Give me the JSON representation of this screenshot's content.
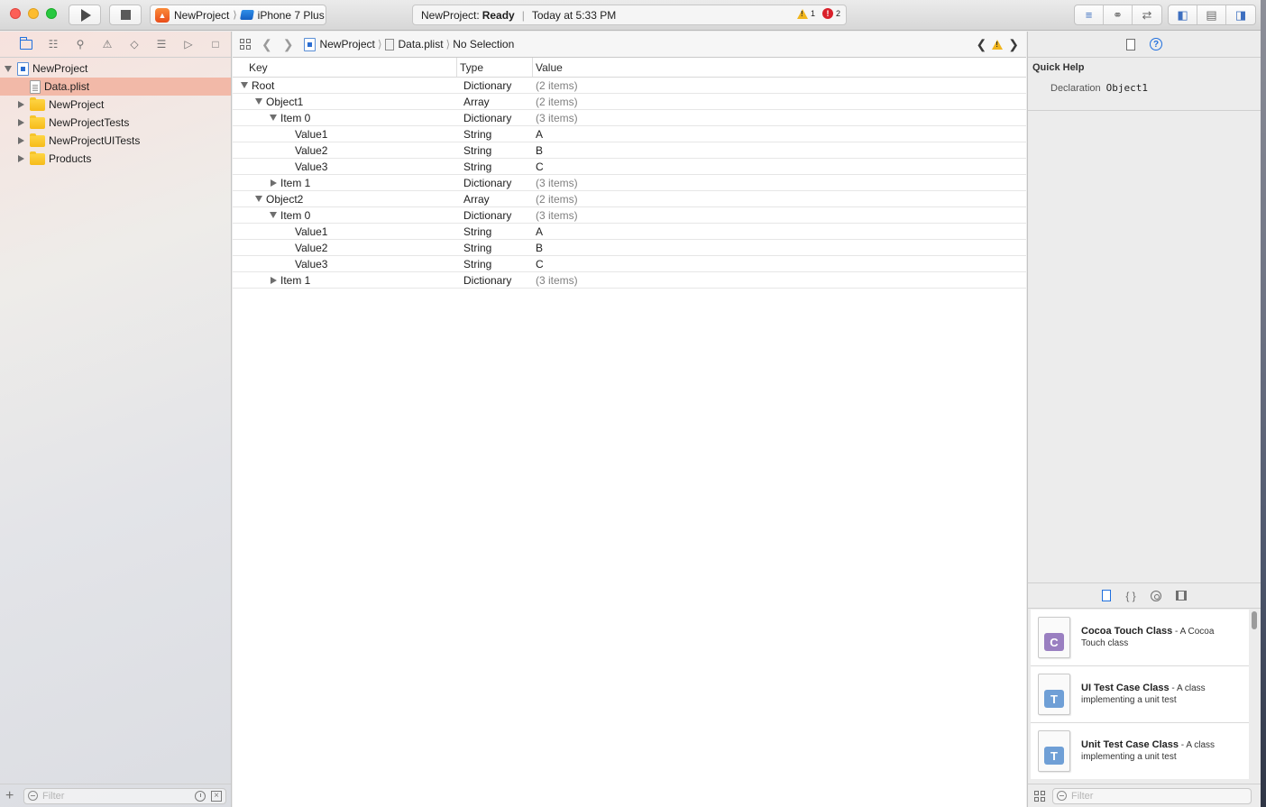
{
  "toolbar": {
    "scheme": {
      "project": "NewProject",
      "device": "iPhone 7 Plus"
    },
    "activity": {
      "project": "NewProject:",
      "status": "Ready",
      "time": "Today at 5:33 PM",
      "warnings": "1",
      "errors": "2"
    }
  },
  "navigator": {
    "tree": [
      {
        "label": "NewProject",
        "kind": "project",
        "level": 0,
        "expanded": true
      },
      {
        "label": "Data.plist",
        "kind": "file",
        "level": 1,
        "selected": true
      },
      {
        "label": "NewProject",
        "kind": "folder",
        "level": 1
      },
      {
        "label": "NewProjectTests",
        "kind": "folder",
        "level": 1
      },
      {
        "label": "NewProjectUITests",
        "kind": "folder",
        "level": 1
      },
      {
        "label": "Products",
        "kind": "folder",
        "level": 1
      }
    ],
    "filter_placeholder": "Filter"
  },
  "jumpbar": {
    "project": "NewProject",
    "file": "Data.plist",
    "selection": "No Selection"
  },
  "plist": {
    "columns": {
      "key": "Key",
      "type": "Type",
      "value": "Value"
    },
    "rows": [
      {
        "key": "Root",
        "type": "Dictionary",
        "value": "(2 items)",
        "level": 0,
        "disclosure": "down"
      },
      {
        "key": "Object1",
        "type": "Array",
        "value": "(2 items)",
        "level": 1,
        "disclosure": "down"
      },
      {
        "key": "Item 0",
        "type": "Dictionary",
        "value": "(3 items)",
        "level": 2,
        "disclosure": "down"
      },
      {
        "key": "Value1",
        "type": "String",
        "value": "A",
        "level": 3,
        "disclosure": "none"
      },
      {
        "key": "Value2",
        "type": "String",
        "value": "B",
        "level": 3,
        "disclosure": "none"
      },
      {
        "key": "Value3",
        "type": "String",
        "value": "C",
        "level": 3,
        "disclosure": "none"
      },
      {
        "key": "Item 1",
        "type": "Dictionary",
        "value": "(3 items)",
        "level": 2,
        "disclosure": "right"
      },
      {
        "key": "Object2",
        "type": "Array",
        "value": "(2 items)",
        "level": 1,
        "disclosure": "down"
      },
      {
        "key": "Item 0",
        "type": "Dictionary",
        "value": "(3 items)",
        "level": 2,
        "disclosure": "down"
      },
      {
        "key": "Value1",
        "type": "String",
        "value": "A",
        "level": 3,
        "disclosure": "none"
      },
      {
        "key": "Value2",
        "type": "String",
        "value": "B",
        "level": 3,
        "disclosure": "none"
      },
      {
        "key": "Value3",
        "type": "String",
        "value": "C",
        "level": 3,
        "disclosure": "none"
      },
      {
        "key": "Item 1",
        "type": "Dictionary",
        "value": "(3 items)",
        "level": 2,
        "disclosure": "right"
      }
    ]
  },
  "quick_help": {
    "title": "Quick Help",
    "declaration_label": "Declaration",
    "declaration_value": "Object1"
  },
  "library": {
    "items": [
      {
        "letter": "C",
        "color": "#9a7fc1",
        "title": "Cocoa Touch Class",
        "desc": " - A Cocoa Touch class"
      },
      {
        "letter": "T",
        "color": "#6f9fd6",
        "title": "UI Test Case Class",
        "desc": " - A class implementing a unit test"
      },
      {
        "letter": "T",
        "color": "#6f9fd6",
        "title": "Unit Test Case Class",
        "desc": " - A class implementing a unit test"
      }
    ],
    "filter_placeholder": "Filter"
  },
  "colors": {
    "accent": "#1f6fde",
    "selection": "#f2b9a8",
    "warning": "#f1b51c",
    "error": "#d9202a"
  }
}
